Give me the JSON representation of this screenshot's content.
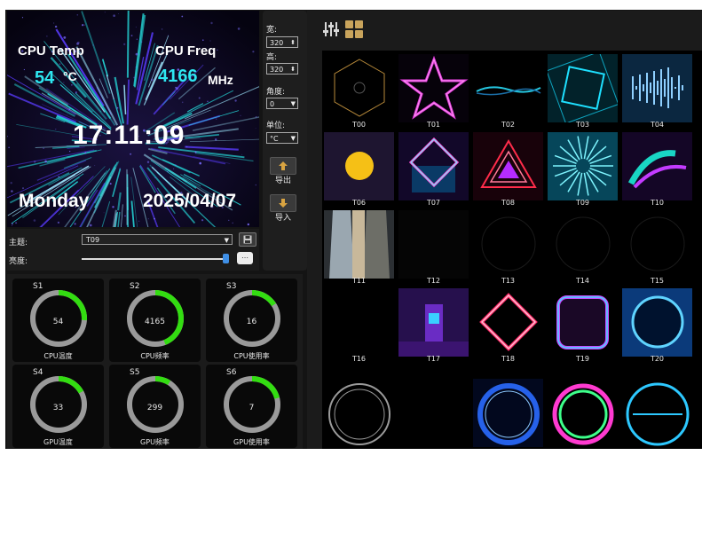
{
  "preview": {
    "cpu_temp_label": "CPU Temp",
    "cpu_temp_value": "54",
    "cpu_temp_unit": "°C",
    "cpu_freq_label": "CPU Freq",
    "cpu_freq_value": "4166",
    "cpu_freq_unit": "MHz",
    "time": "17:11:09",
    "weekday": "Monday",
    "date": "2025/04/07"
  },
  "settings": {
    "width_label": "宽:",
    "width_value": "320",
    "height_label": "高:",
    "height_value": "320",
    "angle_label": "角度:",
    "angle_value": "0",
    "unit_label": "单位:",
    "unit_value": "°C",
    "export_label": "导出",
    "import_label": "导入"
  },
  "theme": {
    "label": "主题:",
    "selected": "T09",
    "brightness_label": "亮度:",
    "brightness_level": 1.0
  },
  "gauges": [
    {
      "id": "S1",
      "value": "54",
      "name": "CPU温度",
      "fraction": 0.26
    },
    {
      "id": "S2",
      "value": "4165",
      "name": "CPU频率",
      "fraction": 0.44
    },
    {
      "id": "S3",
      "value": "16",
      "name": "CPU使用率",
      "fraction": 0.16
    },
    {
      "id": "S4",
      "value": "33",
      "name": "GPU温度",
      "fraction": 0.17
    },
    {
      "id": "S5",
      "value": "299",
      "name": "GPU频率",
      "fraction": 0.09
    },
    {
      "id": "S6",
      "value": "7",
      "name": "GPU使用率",
      "fraction": 0.21
    }
  ],
  "gauge_colors": {
    "fill": "#33dd11",
    "track": "#9a9a9a"
  },
  "themes": [
    "T00",
    "T01",
    "T02",
    "T03",
    "T04",
    "T06",
    "T07",
    "T08",
    "T09",
    "T10",
    "T11",
    "T12",
    "T13",
    "T14",
    "T15",
    "T16",
    "T17",
    "T18",
    "T19",
    "T20"
  ],
  "icons": {
    "toolbar_1": "sliders-icon",
    "toolbar_2": "grid-icon",
    "export": "arrow-up-icon",
    "import": "arrow-down-icon",
    "save": "save-icon"
  }
}
